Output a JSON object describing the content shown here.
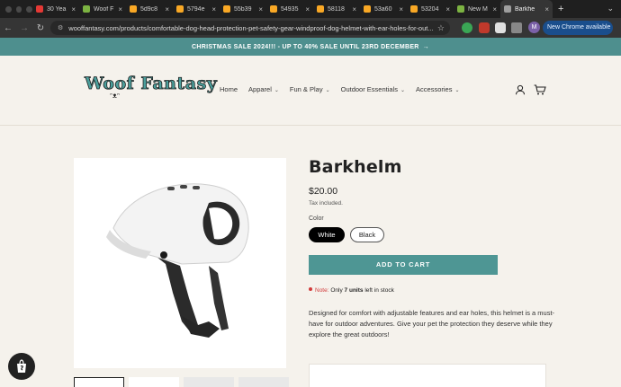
{
  "browser": {
    "tabs": [
      {
        "label": "30 Yea",
        "color": "#e53935",
        "active": false
      },
      {
        "label": "Woof F",
        "color": "#7cb342",
        "active": false
      },
      {
        "label": "5d9c8",
        "color": "#f9a825",
        "active": false
      },
      {
        "label": "5794e",
        "color": "#f9a825",
        "active": false
      },
      {
        "label": "55b39",
        "color": "#f9a825",
        "active": false
      },
      {
        "label": "54935",
        "color": "#f9a825",
        "active": false
      },
      {
        "label": "58118",
        "color": "#f9a825",
        "active": false
      },
      {
        "label": "53a60",
        "color": "#f9a825",
        "active": false
      },
      {
        "label": "53204",
        "color": "#f9a825",
        "active": false
      },
      {
        "label": "New M",
        "color": "#7cb342",
        "active": false
      },
      {
        "label": "Barkhe",
        "color": "#9e9e9e",
        "active": true
      }
    ],
    "url": "wooffantasy.com/products/comfortable-dog-head-protection-pet-safety-gear-windproof-dog-helmet-with-ear-holes-for-out...",
    "profile_initial": "M",
    "update_label": "New Chrome available"
  },
  "announcement": {
    "text": "CHRISTMAS SALE 2024!!! - UP TO 40% SALE UNTIL 23RD DECEMBER",
    "bg_color": "#4e8f8e"
  },
  "header": {
    "logo_text": "Woof Fantasy",
    "nav": [
      {
        "label": "Home",
        "has_dropdown": false
      },
      {
        "label": "Apparel",
        "has_dropdown": true
      },
      {
        "label": "Fun & Play",
        "has_dropdown": true
      },
      {
        "label": "Outdoor Essentials",
        "has_dropdown": true
      },
      {
        "label": "Accessories",
        "has_dropdown": true
      }
    ],
    "icons": [
      "account-icon",
      "cart-icon"
    ]
  },
  "product": {
    "title": "Barkhelm",
    "price": "$20.00",
    "tax_note": "Tax included.",
    "color_label": "Color",
    "colors": [
      "White",
      "Black"
    ],
    "selected_color": "White",
    "add_to_cart": "ADD TO CART",
    "stock_note": {
      "label": "Note:",
      "text_pre": "Only",
      "highlight": "7 units",
      "text_post": "left in stock"
    },
    "description": "Designed for comfort with adjustable features and ear holes, this helmet is a must-have for outdoor adventures. Give your pet the protection they deserve while they explore the great outdoors!",
    "accent_color": "#4e9694"
  }
}
